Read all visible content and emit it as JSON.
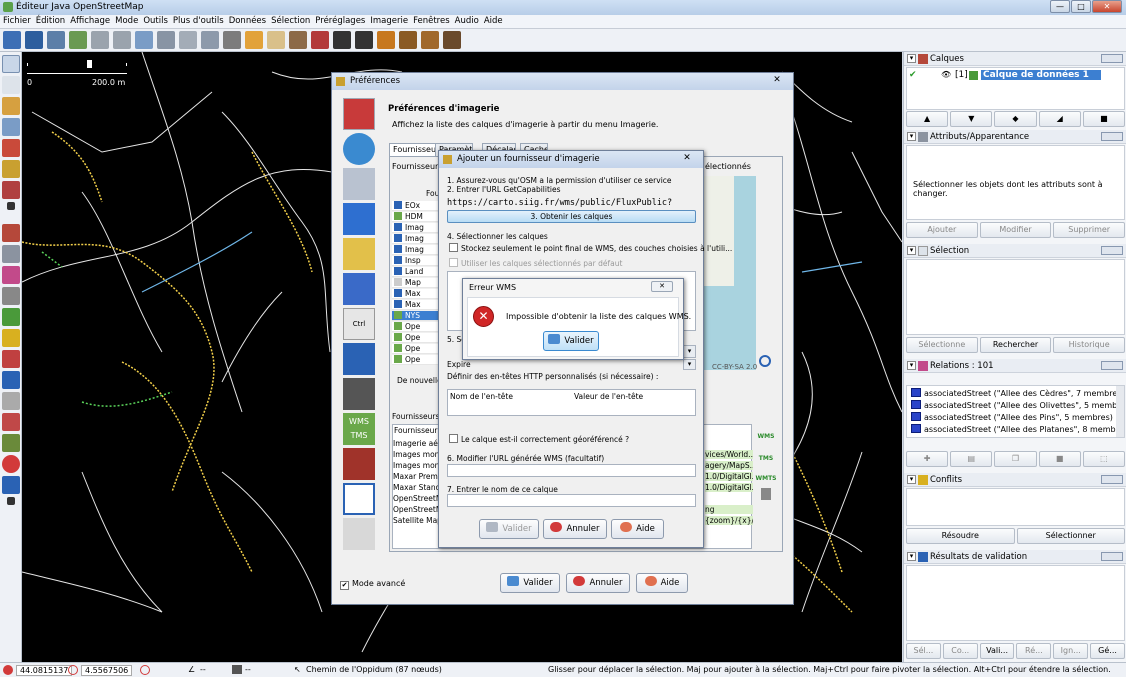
{
  "window": {
    "title": "Éditeur Java OpenStreetMap",
    "min": "—",
    "max": "□",
    "close": "✕"
  },
  "menu": [
    "Fichier",
    "Édition",
    "Affichage",
    "Mode",
    "Outils",
    "Plus d'outils",
    "Données",
    "Sélection",
    "Préréglages",
    "Imagerie",
    "Fenêtres",
    "Audio",
    "Aide"
  ],
  "map": {
    "scale_zero": "0",
    "scale_len": "200.0 m"
  },
  "panels": {
    "layers": {
      "title": "Calques",
      "layer_index": "[1]",
      "layer_name": "Calque de données 1"
    },
    "attributes": {
      "title": "Attributs/Apparentance",
      "empty": "Sélectionner les objets dont les attributs sont à changer.",
      "add": "Ajouter",
      "modify": "Modifier",
      "delete": "Supprimer"
    },
    "selection": {
      "title": "Sélection",
      "select": "Sélectionne",
      "search": "Rechercher",
      "history": "Historique"
    },
    "relations": {
      "title": "Relations : 101",
      "items": [
        "associatedStreet (\"Allee des Cèdres\", 7 membres)",
        "associatedStreet (\"Allee des Olivettes\", 5 membres)",
        "associatedStreet (\"Allee des Pins\", 5 membres)",
        "associatedStreet (\"Allee des Platanes\", 8 membres)"
      ]
    },
    "conflicts": {
      "title": "Conflits",
      "resolve": "Résoudre",
      "select": "Sélectionner"
    },
    "validation": {
      "title": "Résultats de validation",
      "buttons": [
        "Sél...",
        "Co...",
        "Vali...",
        "Ré...",
        "Ign...",
        "Gé..."
      ]
    }
  },
  "status": {
    "lat": "44.0815137",
    "lon": "4.5567506",
    "angle": "--",
    "dist": "--",
    "way": "Chemin de l'Oppidum (87 nœuds)",
    "help": "Glisser pour déplacer la sélection. Maj pour ajouter à la sélection. Maj+Ctrl pour faire pivoter la sélection. Alt+Ctrl pour étendre la sélection."
  },
  "prefs": {
    "title": "Préférences",
    "heading": "Préférences d'imagerie",
    "subheading": "Affichez la liste des calques d'imagerie à partir du menu Imagerie.",
    "tabs": [
      "Fournisseurs",
      "Paramètres",
      "Décalage",
      "Cache"
    ],
    "providers_label": "Fournisseurs",
    "selected_label": "électionnés",
    "col_header": "Fou",
    "rows": [
      "EOx",
      "HDM",
      "Imag",
      "Imag",
      "Imag",
      "Insp",
      "Land",
      "Map",
      "Max",
      "Max",
      "NYS",
      "Ope",
      "Ope",
      "Ope",
      "Ope"
    ],
    "new_label": "De nouvelles",
    "providers_section": "Fournisseurs a",
    "col2": "Fournisseur",
    "list2": [
      "Imagerie aérie",
      "Images mondi",
      "Images mondi",
      "Maxar Premiu",
      "Maxar Standa",
      "OpenStreetMa",
      "OpenStreetMa",
      "Satellite Mapb"
    ],
    "urls": [
      "vices/World...",
      "agery/MapS...",
      "1.0/DigitalGl...",
      "1.0/DigitalGl...",
      "ng",
      "{zoom}/{x}/{..."
    ],
    "add_wms": "WMS",
    "add_tms": "TMS",
    "add_wmts": "WMTS",
    "attrib": "CC-BY-SA 2.0",
    "side_wms": "WMS",
    "side_tms": "TMS",
    "advanced": "Mode avancé",
    "ok": "Valider",
    "cancel": "Annuler",
    "help": "Aide"
  },
  "add_provider": {
    "title": "Ajouter un fournisseur d'imagerie",
    "step1": "1. Assurez-vous qu'OSM a la permission d'utiliser ce service",
    "step2": "2. Entrer l'URL GetCapabilities",
    "url": "https://carto.siig.fr/wms/public/FluxPublic?",
    "get_layers": "3. Obtenir les calques",
    "step4": "4. Sélectionner les calques",
    "store_endpoint": "Stockez seulement le point final de WMS, des couches choisies à l'utili...",
    "use_default": "Utiliser les calques sélectionnés par défaut",
    "step5": "5. Sé",
    "expire": "Expire",
    "headers_label": "Définir des en-têtes HTTP personnalisés (si nécessaire) :",
    "header_name": "Nom de l'en-tête",
    "header_value": "Valeur de l'en-tête",
    "georef": "Le calque est-il correctement géoréférencé ?",
    "step6": "6. Modifier l'URL générée WMS (facultatif)",
    "step7": "7. Entrer le nom de ce calque",
    "ok": "Valider",
    "cancel": "Annuler",
    "help": "Aide"
  },
  "error": {
    "title": "Erreur WMS",
    "message": "Impossible d'obtenir la liste des calques WMS.",
    "ok": "Valider",
    "close": "✕"
  }
}
